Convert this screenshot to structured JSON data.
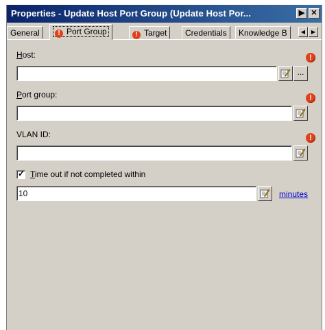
{
  "window": {
    "title": "Properties - Update Host Port Group (Update Host Por...",
    "pin_glyph": "▶",
    "close_glyph": "✕"
  },
  "tabs": [
    {
      "label": "General",
      "error": false
    },
    {
      "label": "Port Group",
      "error": true,
      "active": true
    },
    {
      "label": "Target",
      "error": true
    },
    {
      "label": "Credentials",
      "error": false
    },
    {
      "label": "Knowledge B",
      "error": false
    }
  ],
  "tab_scroll": {
    "left": "◀",
    "right": "▶"
  },
  "error_glyph": "!",
  "fields": {
    "host": {
      "label_access": "H",
      "label_rest": "ost:",
      "value": "",
      "browse_label": "..."
    },
    "port_group": {
      "label_access": "P",
      "label_rest": "ort group:",
      "value": ""
    },
    "vlan_id": {
      "label": "VLAN ID:",
      "value": ""
    }
  },
  "timeout": {
    "checked": true,
    "check_glyph": "✓",
    "label_access": "T",
    "label_rest": "ime out if not completed within",
    "value": "10",
    "unit_link": "minutes"
  },
  "colors": {
    "error": "#e0401a",
    "link": "#0000cc",
    "titlebar": "#0a246a",
    "panel": "#d4d0c8"
  }
}
